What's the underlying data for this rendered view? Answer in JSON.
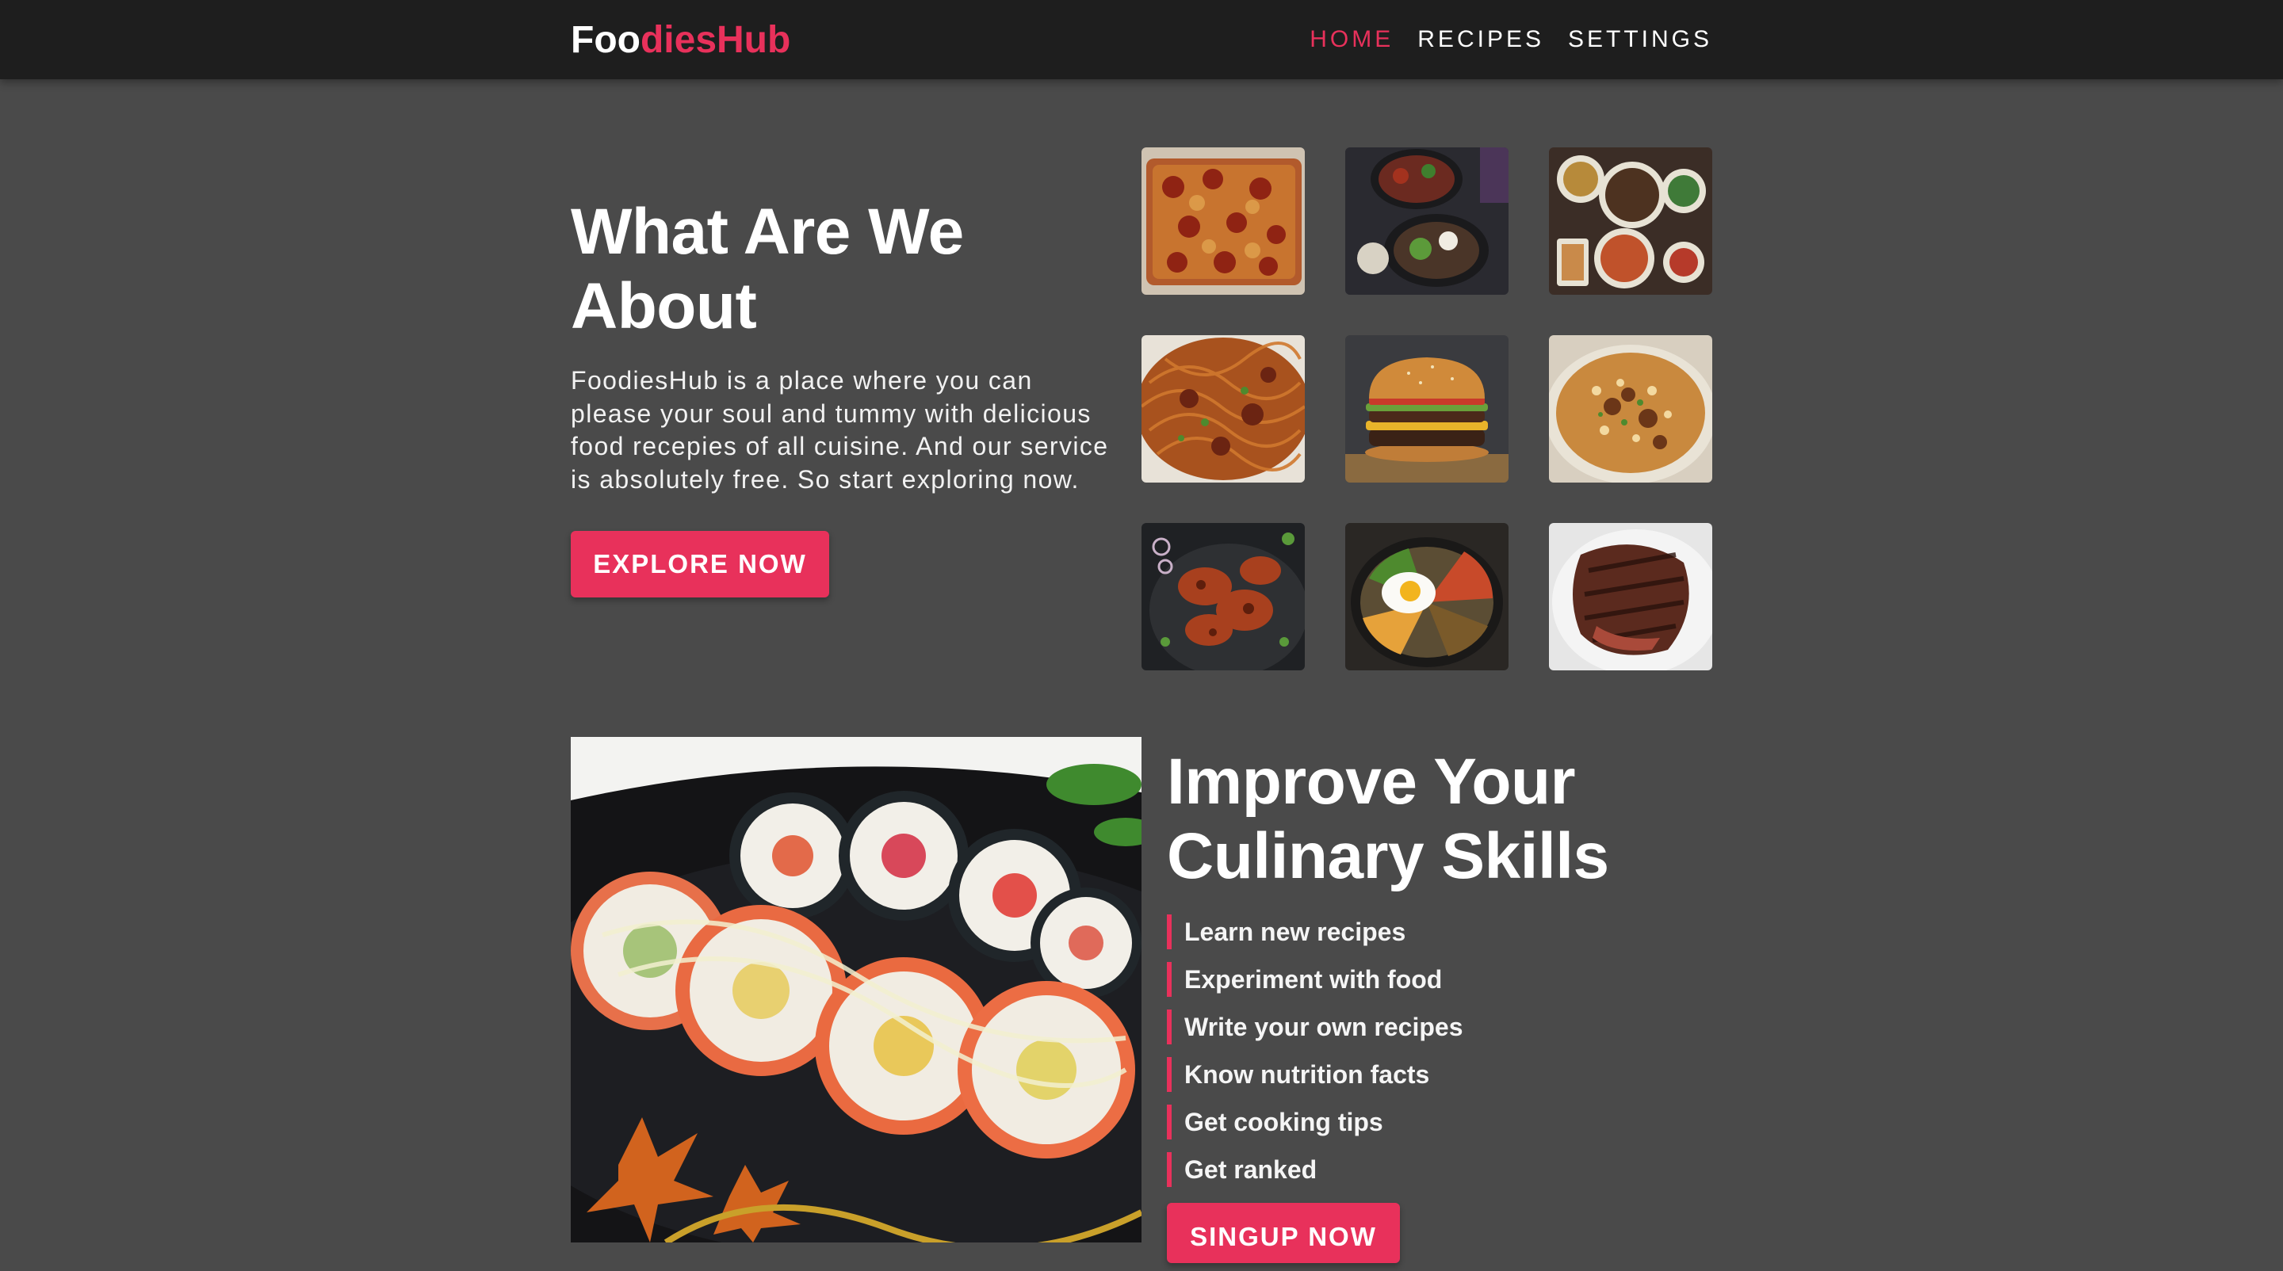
{
  "brand": {
    "part1": "Foo",
    "part2": "diesHub"
  },
  "nav": {
    "items": [
      {
        "label": "HOME",
        "active": true
      },
      {
        "label": "RECIPES",
        "active": false
      },
      {
        "label": "SETTINGS",
        "active": false
      }
    ]
  },
  "about": {
    "title": "What Are We About",
    "description": "FoodiesHub is a place where you can please your soul and tummy with delicious food recepies of all cuisine. And our service is absolutely free. So start exploring now.",
    "button_label": "EXPLORE NOW"
  },
  "gallery": {
    "images": [
      "pizza",
      "rice-bowls",
      "noodle-spread",
      "spaghetti",
      "burger",
      "biryani",
      "tandoori-chicken",
      "bibimbap",
      "grilled-steak"
    ]
  },
  "skills": {
    "image": "sushi-rolls",
    "title": "Improve Your Culinary Skills",
    "items": [
      "Learn new recipes",
      "Experiment with food",
      "Write your own recipes",
      "Know nutrition facts",
      "Get cooking tips",
      "Get ranked"
    ],
    "button_label": "SINGUP NOW"
  },
  "colors": {
    "accent": "#e8315b",
    "navbar": "#1e1e1e",
    "background": "#4a4a4a"
  }
}
